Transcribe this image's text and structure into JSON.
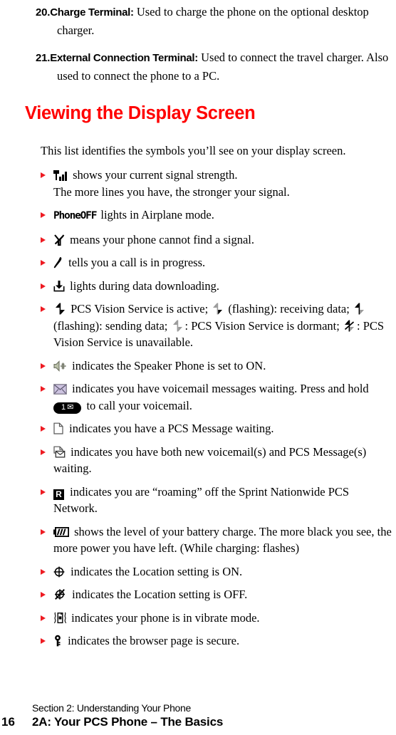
{
  "numbered_items": [
    {
      "number": "20.",
      "lead": "Charge Terminal:",
      "text": " Used to charge the phone on the optional desktop charger."
    },
    {
      "number": "21.",
      "lead": "External Connection Terminal:",
      "text": " Used to connect the travel charger. Also used to connect the phone to a PC."
    }
  ],
  "heading": "Viewing the Display Screen",
  "intro": "This list identifies the symbols you’ll see on your display screen.",
  "bullets": {
    "signal": {
      "icon": "signal-strength-icon",
      "text": " shows your current signal strength.",
      "line2": "The more lines you have, the stronger your signal."
    },
    "phoneoff": {
      "label": "PhoneOFF",
      "text": " lights in Airplane mode."
    },
    "nosignal": {
      "icon": "no-signal-icon",
      "text": " means your phone cannot find a signal."
    },
    "call": {
      "icon": "call-in-progress-icon",
      "text": " tells you a call is in progress."
    },
    "download": {
      "icon": "data-download-icon",
      "text": " lights during data downloading."
    },
    "vision": {
      "part1": " PCS Vision Service is active;",
      "part2": " (flashing): receiving data;",
      "part3": " (flashing): sending data;",
      "part4": ": PCS Vision Service is dormant;",
      "part5": ": PCS Vision Service is unavailable."
    },
    "speaker": {
      "icon": "speaker-phone-icon",
      "text": " indicates the Speaker Phone is set to ON."
    },
    "voicemail": {
      "icon": "voicemail-envelope-icon",
      "text": " indicates you have voicemail messages waiting. Press and hold",
      "key_digit": "1",
      "key_glyph": "✉",
      "text2": " to call your voicemail."
    },
    "message": {
      "icon": "pcs-message-icon",
      "text": " indicates you have a PCS Message waiting."
    },
    "both": {
      "icon": "voicemail-and-message-icon",
      "text": " indicates you have both new voicemail(s) and PCS Message(s) waiting."
    },
    "roaming": {
      "icon": "roaming-icon",
      "icon_label": "R",
      "text": " indicates you are “roaming” off the Sprint Nationwide PCS Network."
    },
    "battery": {
      "icon": "battery-icon",
      "text": " shows the level of your battery charge. The more black you see, the more power you have left. (While charging: flashes)"
    },
    "location_on": {
      "icon": "location-on-icon",
      "text": " indicates the Location setting is ON."
    },
    "location_off": {
      "icon": "location-off-icon",
      "text": " indicates the Location setting is OFF."
    },
    "vibrate": {
      "icon": "vibrate-mode-icon",
      "text": " indicates your phone is in vibrate mode."
    },
    "secure": {
      "icon": "secure-page-icon",
      "text": " indicates the browser page is secure."
    }
  },
  "footer": {
    "page_number": "16",
    "section": "Section 2: Understanding Your Phone",
    "chapter": "2A: Your PCS Phone – The Basics"
  },
  "colors": {
    "accent_red": "#ff0000",
    "bullet_red": "#ee1b22",
    "text_black": "#000000"
  }
}
